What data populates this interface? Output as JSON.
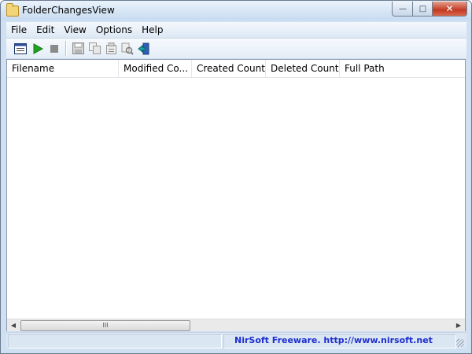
{
  "window": {
    "title": "FolderChangesView"
  },
  "menu": [
    "File",
    "Edit",
    "View",
    "Options",
    "Help"
  ],
  "toolbar": {
    "icons": [
      "select-folder-icon",
      "start-icon",
      "stop-icon",
      "save-icon",
      "copy-icon",
      "properties-icon",
      "find-icon",
      "exit-icon"
    ],
    "colors": {
      "play": "#1fa41f",
      "stop": "#8a8a8a"
    }
  },
  "table": {
    "columns": [
      "Filename",
      "Modified Co...",
      "Created Count",
      "Deleted Count",
      "Full Path"
    ],
    "rows": []
  },
  "status": {
    "link_text": "NirSoft Freeware.  http://www.nirsoft.net",
    "link_color": "#1e2fcf"
  },
  "scrollbar": {
    "thumb_grip": "III"
  }
}
